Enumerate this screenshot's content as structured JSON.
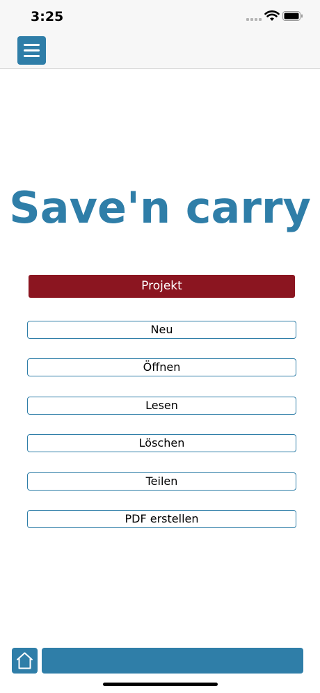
{
  "status_bar": {
    "time": "3:25"
  },
  "icons": {
    "menu": "hamburger-menu-icon",
    "home": "home-icon",
    "wifi": "wifi-icon",
    "battery": "battery-icon"
  },
  "main": {
    "title": "Save'n carry",
    "section_header": "Projekt",
    "actions": [
      {
        "label": "Neu"
      },
      {
        "label": "Öffnen"
      },
      {
        "label": "Lesen"
      },
      {
        "label": "Löschen"
      },
      {
        "label": "Teilen"
      },
      {
        "label": "PDF erstellen"
      }
    ]
  },
  "colors": {
    "accent": "#2f7ea8",
    "header": "#8b1520"
  }
}
